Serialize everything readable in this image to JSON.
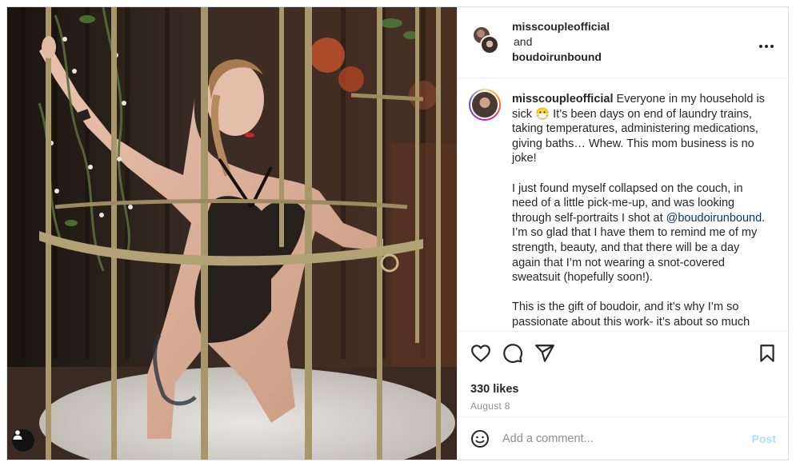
{
  "header": {
    "owner1": "misscoupleofficial",
    "joiner": "and",
    "owner2": "boudoirunbound"
  },
  "icons": {
    "more": "more-options-icon",
    "like": "heart-icon",
    "comment": "comment-icon",
    "share": "send-icon",
    "save": "bookmark-icon",
    "emoji": "emoji-icon",
    "tagged_user": "user-tag-icon"
  },
  "caption": {
    "username": "misscoupleofficial",
    "para1": "Everyone in my household is sick 😷 It’s been days on end of laundry trains, taking temperatures, administering medications, giving baths… Whew. This mom business is no joke!",
    "para2_before": "I just found myself collapsed on the couch, in need of a little pick-me-up, and was looking through self-portraits I shot at",
    "mention": "@boudoirunbound",
    "para2_after": ". I’m so glad that I have them to remind me of my strength, beauty, and that there will be a day again that I’m not wearing a snot-covered sweatsuit (hopefully soon!).",
    "para3": "This is the gift of boudoir, and it’s why I’m so passionate about this work- it’s about so much"
  },
  "stats": {
    "likes": "330 likes",
    "date": "August 8"
  },
  "comment": {
    "placeholder": "Add a comment...",
    "post_label": "Post"
  },
  "colors": {
    "text": "#262626",
    "muted": "#8e8e8e",
    "link": "#00376b",
    "post_disabled": "#b2dffc",
    "divider": "#efefef"
  }
}
